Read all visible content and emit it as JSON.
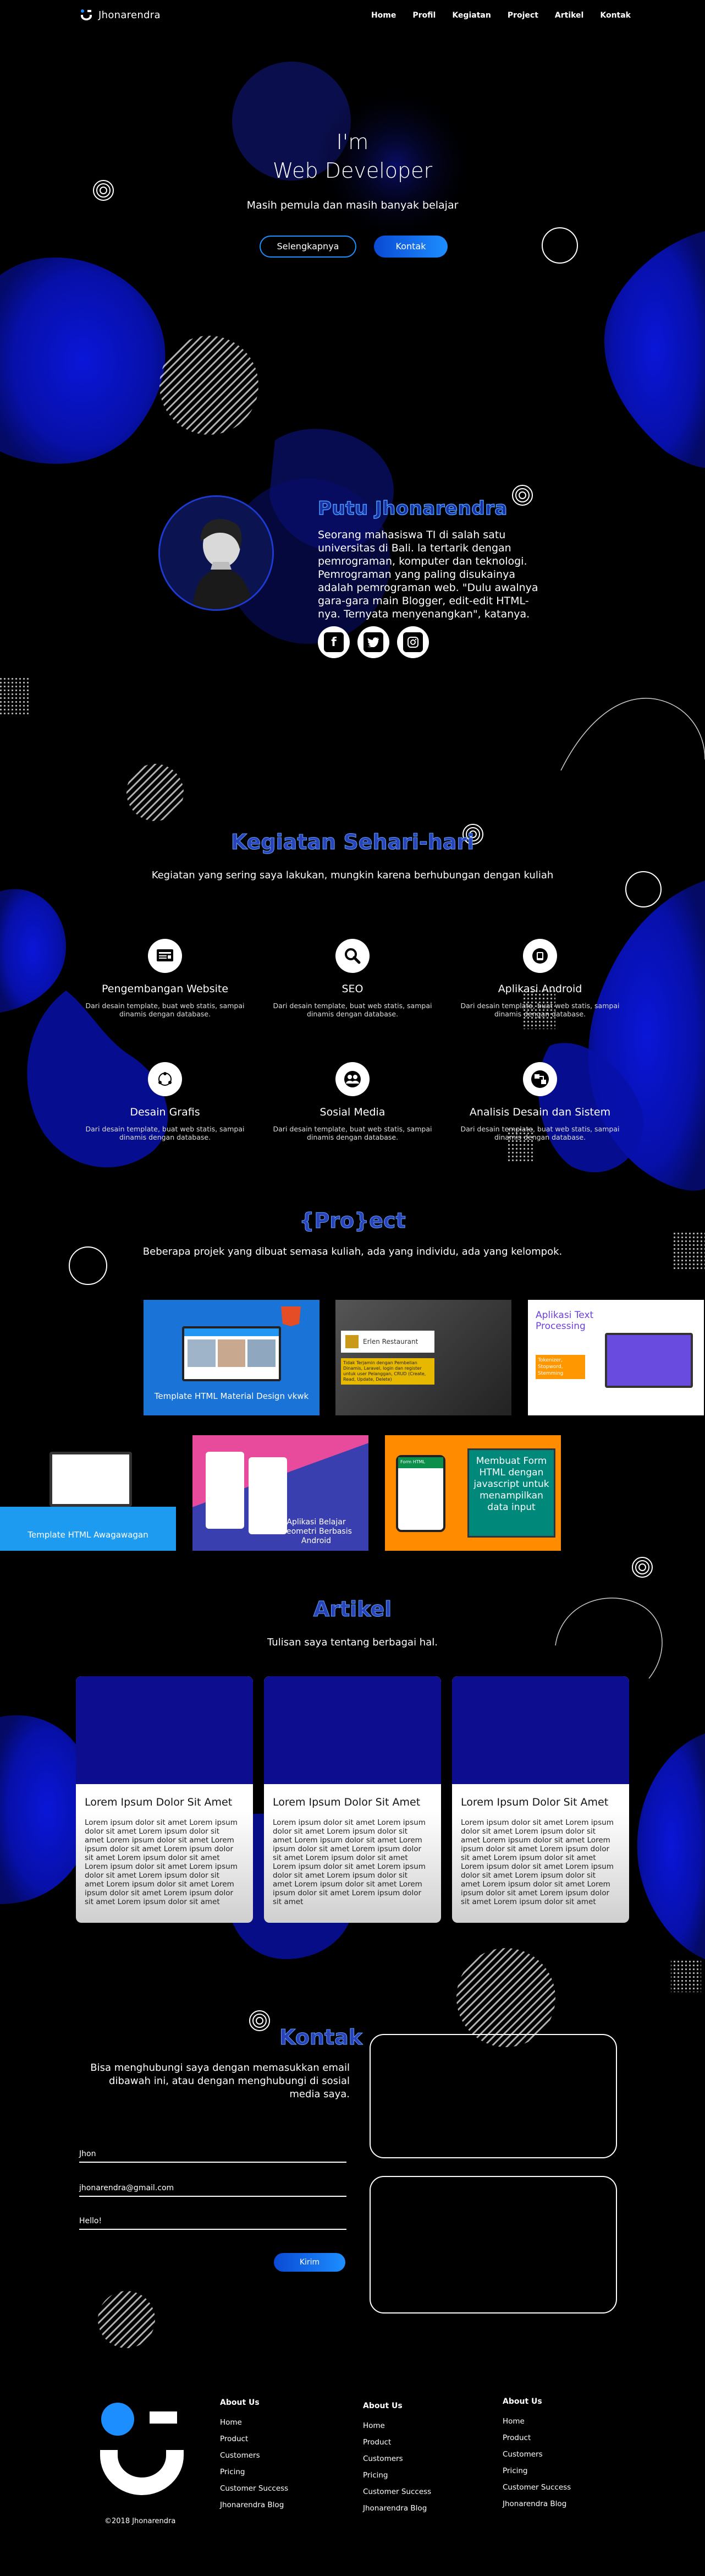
{
  "nav": {
    "brand": "Jhonarendra",
    "links": [
      "Home",
      "Profil",
      "Kegiatan",
      "Project",
      "Artikel",
      "Kontak"
    ]
  },
  "hero": {
    "title_line1": "I'm",
    "title_line2": "Web Developer",
    "subtitle": "Masih pemula dan masih banyak belajar",
    "btn_more": "Selengkapnya",
    "btn_contact": "Kontak"
  },
  "profile": {
    "name": "Putu Jhonarendra",
    "description": "Seorang mahasiswa TI di salah satu universitas di Bali. la tertarik dengan pemrograman, komputer dan teknologi. Pemrograman yang paling disukainya adalah pemrograman web. \"Dulu awalnya gara-gara main Blogger, edit-edit HTML-nya. Ternyata menyenangkan\", katanya.",
    "socials": [
      "facebook-icon",
      "twitter-icon",
      "instagram-icon"
    ]
  },
  "services": {
    "title": "Kegiatan Sehari-hari",
    "subtitle": "Kegiatan yang sering saya lakukan, mungkin karena berhubungan dengan kuliah",
    "items": [
      {
        "title": "Pengembangan Website",
        "desc": "Dari desain template, buat web statis, sampai dinamis dengan database.",
        "icon": "website-icon"
      },
      {
        "title": "SEO",
        "desc": "Dari desain template, buat web statis, sampai dinamis dengan database.",
        "icon": "search-icon"
      },
      {
        "title": "Aplikasi Android",
        "desc": "Dari desain template, buat web statis, sampai dinamis dengan database.",
        "icon": "android-icon"
      },
      {
        "title": "Desain Grafis",
        "desc": "Dari desain template, buat web statis, sampai dinamis dengan database.",
        "icon": "design-icon"
      },
      {
        "title": "Sosial Media",
        "desc": "Dari desain template, buat web statis, sampai dinamis dengan database.",
        "icon": "users-icon"
      },
      {
        "title": "Analisis Desain dan Sistem",
        "desc": "Dari desain template, buat web statis, sampai dinamis dengan database.",
        "icon": "system-icon"
      }
    ]
  },
  "projects": {
    "title": "{Pro}ect",
    "subtitle": "Beberapa projek yang dibuat semasa kuliah, ada yang individu, ada yang kelompok.",
    "items": [
      {
        "caption": "Template HTML Material Design vkwk"
      },
      {
        "caption": "Erlen Restaurant",
        "note": "Tidak Terjamin dengan Pembelian Dinamis, Laravel, login dan register untuk user Pelanggan, CRUD (Create, Read, Update, Delete)"
      },
      {
        "caption": "Aplikasi Text Processing",
        "note": "Tokenizer, Stopword, Stemming"
      },
      {
        "caption": "Template HTML Awagawagan"
      },
      {
        "caption": "Aplikasi Belajar Geometri Berbasis Android"
      },
      {
        "caption": "Membuat Form HTML dengan javascript untuk menampilkan data input",
        "note": "Form HTML"
      }
    ]
  },
  "articles": {
    "title": "Artikel",
    "subtitle": "Tulisan saya tentang berbagai hal.",
    "items": [
      {
        "title": "Lorem Ipsum Dolor Sit Amet",
        "text": "Lorem ipsum dolor sit amet Lorem ipsum dolor sit amet Lorem ipsum dolor sit amet Lorem ipsum dolor sit amet Lorem ipsum dolor sit amet Lorem ipsum dolor sit amet Lorem ipsum dolor sit amet Lorem ipsum dolor sit amet Lorem ipsum dolor sit amet Lorem ipsum dolor sit amet Lorem ipsum dolor sit amet Lorem ipsum dolor sit amet Lorem ipsum dolor sit amet Lorem ipsum dolor sit amet"
      },
      {
        "title": "Lorem Ipsum Dolor Sit Amet",
        "text": "Lorem ipsum dolor sit amet Lorem ipsum dolor sit amet Lorem ipsum dolor sit amet Lorem ipsum dolor sit amet Lorem ipsum dolor sit amet Lorem ipsum dolor sit amet Lorem ipsum dolor sit amet Lorem ipsum dolor sit amet Lorem ipsum dolor sit amet Lorem ipsum dolor sit amet Lorem ipsum dolor sit amet Lorem ipsum dolor sit amet Lorem ipsum dolor sit amet"
      },
      {
        "title": "Lorem Ipsum Dolor Sit Amet",
        "text": "Lorem ipsum dolor sit amet Lorem ipsum dolor sit amet Lorem ipsum dolor sit amet Lorem ipsum dolor sit amet Lorem ipsum dolor sit amet Lorem ipsum dolor sit amet Lorem ipsum dolor sit amet Lorem ipsum dolor sit amet Lorem ipsum dolor sit amet Lorem ipsum dolor sit amet Lorem ipsum dolor sit amet Lorem ipsum dolor sit amet Lorem ipsum dolor sit amet Lorem ipsum dolor sit amet"
      }
    ]
  },
  "contact": {
    "title": "Kontak",
    "description": "Bisa menghubungi saya dengan memasukkan email dibawah ini, atau dengan menghubungi di sosial media saya.",
    "name_value": "Jhon",
    "email_value": "jhonarendra@gmail.com",
    "message_value": "Hello!",
    "send_label": "Kirim"
  },
  "footer": {
    "columns": [
      {
        "heading": "About Us",
        "items": [
          "Home",
          "Product",
          "Customers",
          "Pricing",
          "Customer Success",
          "Jhonarendra Blog"
        ]
      },
      {
        "heading": "About Us",
        "items": [
          "Home",
          "Product",
          "Customers",
          "Pricing",
          "Customer Success",
          "Jhonarendra Blog"
        ]
      },
      {
        "heading": "About Us",
        "items": [
          "Home",
          "Product",
          "Customers",
          "Pricing",
          "Customer Success",
          "Jhonarendra Blog"
        ]
      }
    ],
    "copyright": "©2018 Jhonarendra"
  },
  "colors": {
    "accent": "#1d8eff",
    "blob": "#0a14c8",
    "background": "#000000"
  }
}
